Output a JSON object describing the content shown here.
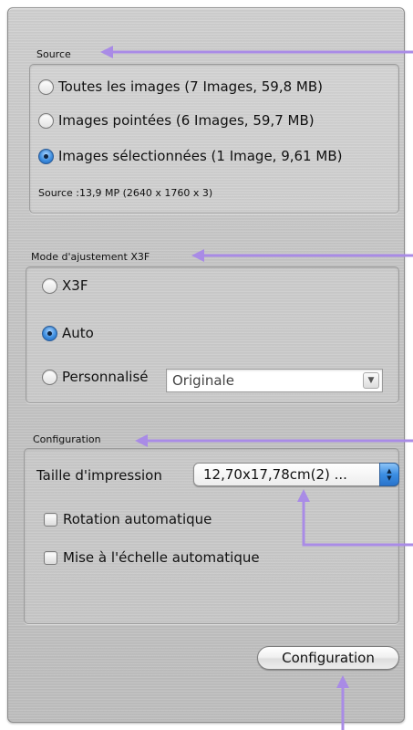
{
  "source": {
    "label": "Source",
    "options": [
      {
        "label": "Toutes les images  (7 Images, 59,8 MB)",
        "selected": false
      },
      {
        "label": "Images pointées  (6 Images, 59,7 MB)",
        "selected": false
      },
      {
        "label": "Images sélectionnées  (1 Image, 9,61 MB)",
        "selected": true
      }
    ],
    "info": "Source :13,9 MP (2640 x 1760 x 3)"
  },
  "mode": {
    "label": "Mode d'ajustement X3F",
    "options": [
      {
        "label": "X3F",
        "selected": false
      },
      {
        "label": "Auto",
        "selected": true
      },
      {
        "label": "Personnalisé",
        "selected": false
      }
    ],
    "custom_value": "Originale"
  },
  "configuration": {
    "label": "Configuration",
    "print_size_label": "Taille d'impression",
    "print_size_value": "12,70x17,78cm(2) ...",
    "checkboxes": [
      {
        "label": "Rotation automatique",
        "checked": false
      },
      {
        "label": "Mise à l'échelle automatique",
        "checked": false
      }
    ],
    "button_label": "Configuration"
  },
  "annotation_color": "#a98be6",
  "icons": {
    "combo_arrow": "chevron-down-icon",
    "stepper": "up-down-stepper-icon"
  }
}
